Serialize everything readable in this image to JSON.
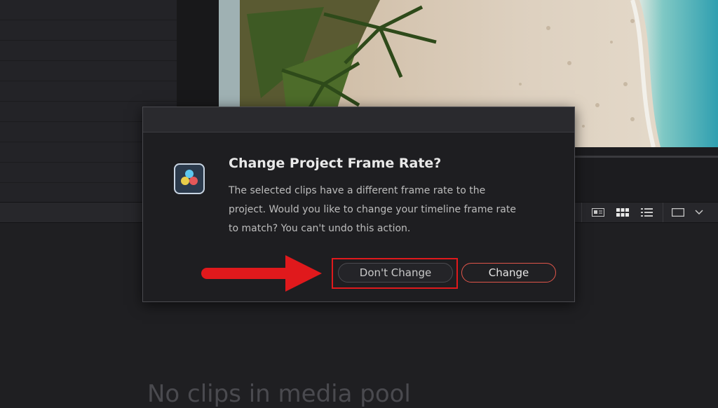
{
  "dialog": {
    "title": "Change Project Frame Rate?",
    "message": "The selected clips have a different frame rate to the project. Would you like to change your timeline frame rate to match? You can't undo this action.",
    "dont_change_label": "Don't Change",
    "change_label": "Change",
    "icon": "davinci-resolve-logo"
  },
  "media_pool": {
    "empty_message": "No clips in media pool"
  },
  "toolbar": {
    "icons": [
      "metadata-view-icon",
      "thumbnail-view-icon",
      "list-view-icon",
      "clip-frame-icon",
      "chevron-down-icon"
    ]
  },
  "annotation": {
    "arrow_color": "#e0191c",
    "highlight_color": "#e0191c"
  },
  "colors": {
    "accent": "#e0554a",
    "background": "#1f1f22"
  }
}
